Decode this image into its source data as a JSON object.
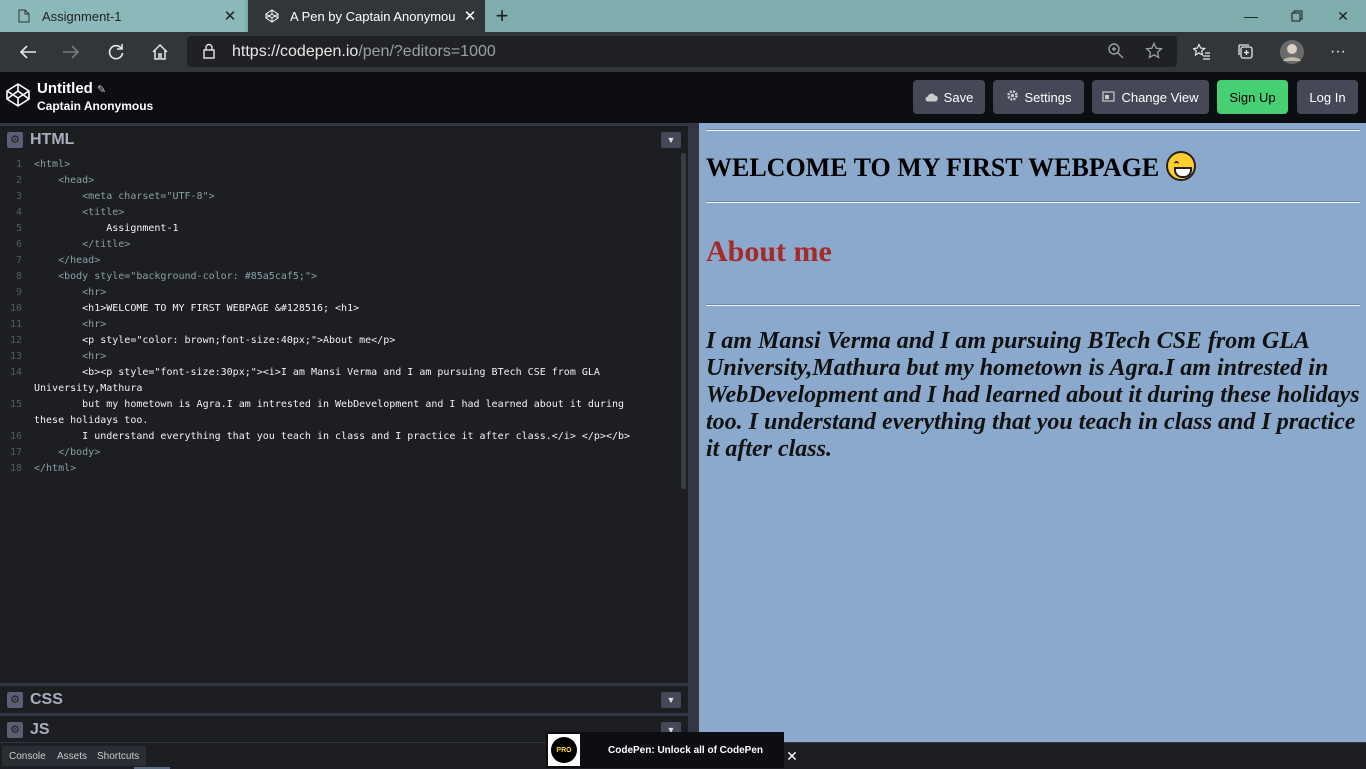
{
  "browser": {
    "tabs": [
      {
        "label": "Assignment-1",
        "active": false
      },
      {
        "label": "A Pen by Captain Anonymous",
        "active": true
      }
    ],
    "url_host": "https://codepen.io",
    "url_path": "/pen/?editors=1000",
    "icons": [
      "back-icon",
      "forward-icon",
      "reload-icon",
      "home-icon",
      "lock-icon",
      "zoom-icon",
      "star-icon",
      "favorites-icon",
      "collections-icon",
      "profile-avatar",
      "more-icon"
    ]
  },
  "codepen": {
    "title": "Untitled",
    "author": "Captain Anonymous",
    "buttons": {
      "save": "Save",
      "settings": "Settings",
      "change_view": "Change View",
      "signup": "Sign Up",
      "login": "Log In"
    }
  },
  "editor": {
    "html_label": "HTML",
    "css_label": "CSS",
    "js_label": "JS",
    "line_numbers": [
      "1",
      "2",
      "3",
      "4",
      "5",
      "6",
      "7",
      "8",
      "9",
      "10",
      "11",
      "12",
      "13",
      "14",
      "15",
      "16",
      "17",
      "18"
    ],
    "lines": [
      "<html>",
      "    <head>",
      "        <meta charset=\"UTF-8\">",
      "        <title>",
      "            Assignment-1",
      "        </title>",
      "    </head>",
      "    <body style=\"background-color: #85a5caf5;\">",
      "        <hr>",
      "        <h1>WELCOME TO MY FIRST WEBPAGE &#128516; <h1>",
      "        <hr>",
      "        <p style=\"color: brown;font-size:40px;\">About me</p>",
      "        <hr>",
      "        <b><p style=\"font-size:30px;\"><i>I am Mansi Verma and I am pursuing BTech CSE from GLA",
      "University,Mathura",
      "        but my hometown is Agra.I am intrested in WebDevelopment and I had learned about it during",
      "these holidays too.",
      "        I understand everything that you teach in class and I practice it after class.</i> </p></b>",
      "    </body>",
      "</html>"
    ]
  },
  "preview": {
    "heading": "WELCOME TO MY FIRST WEBPAGE",
    "about": "About me",
    "paragraph": "I am Mansi Verma and I am pursuing BTech CSE from GLA University,Mathura but my hometown is Agra.I am intrested in WebDevelopment and I had learned about it during these holidays too. I understand everything that you teach in class and I practice it after class.",
    "background_color": "#85a5caf5",
    "about_color": "#a52a2a"
  },
  "footer": {
    "console": "Console",
    "assets": "Assets",
    "shortcuts": "Shortcuts",
    "promo_badge": "PRO",
    "promo_text": "CodePen: Unlock all of CodePen"
  }
}
